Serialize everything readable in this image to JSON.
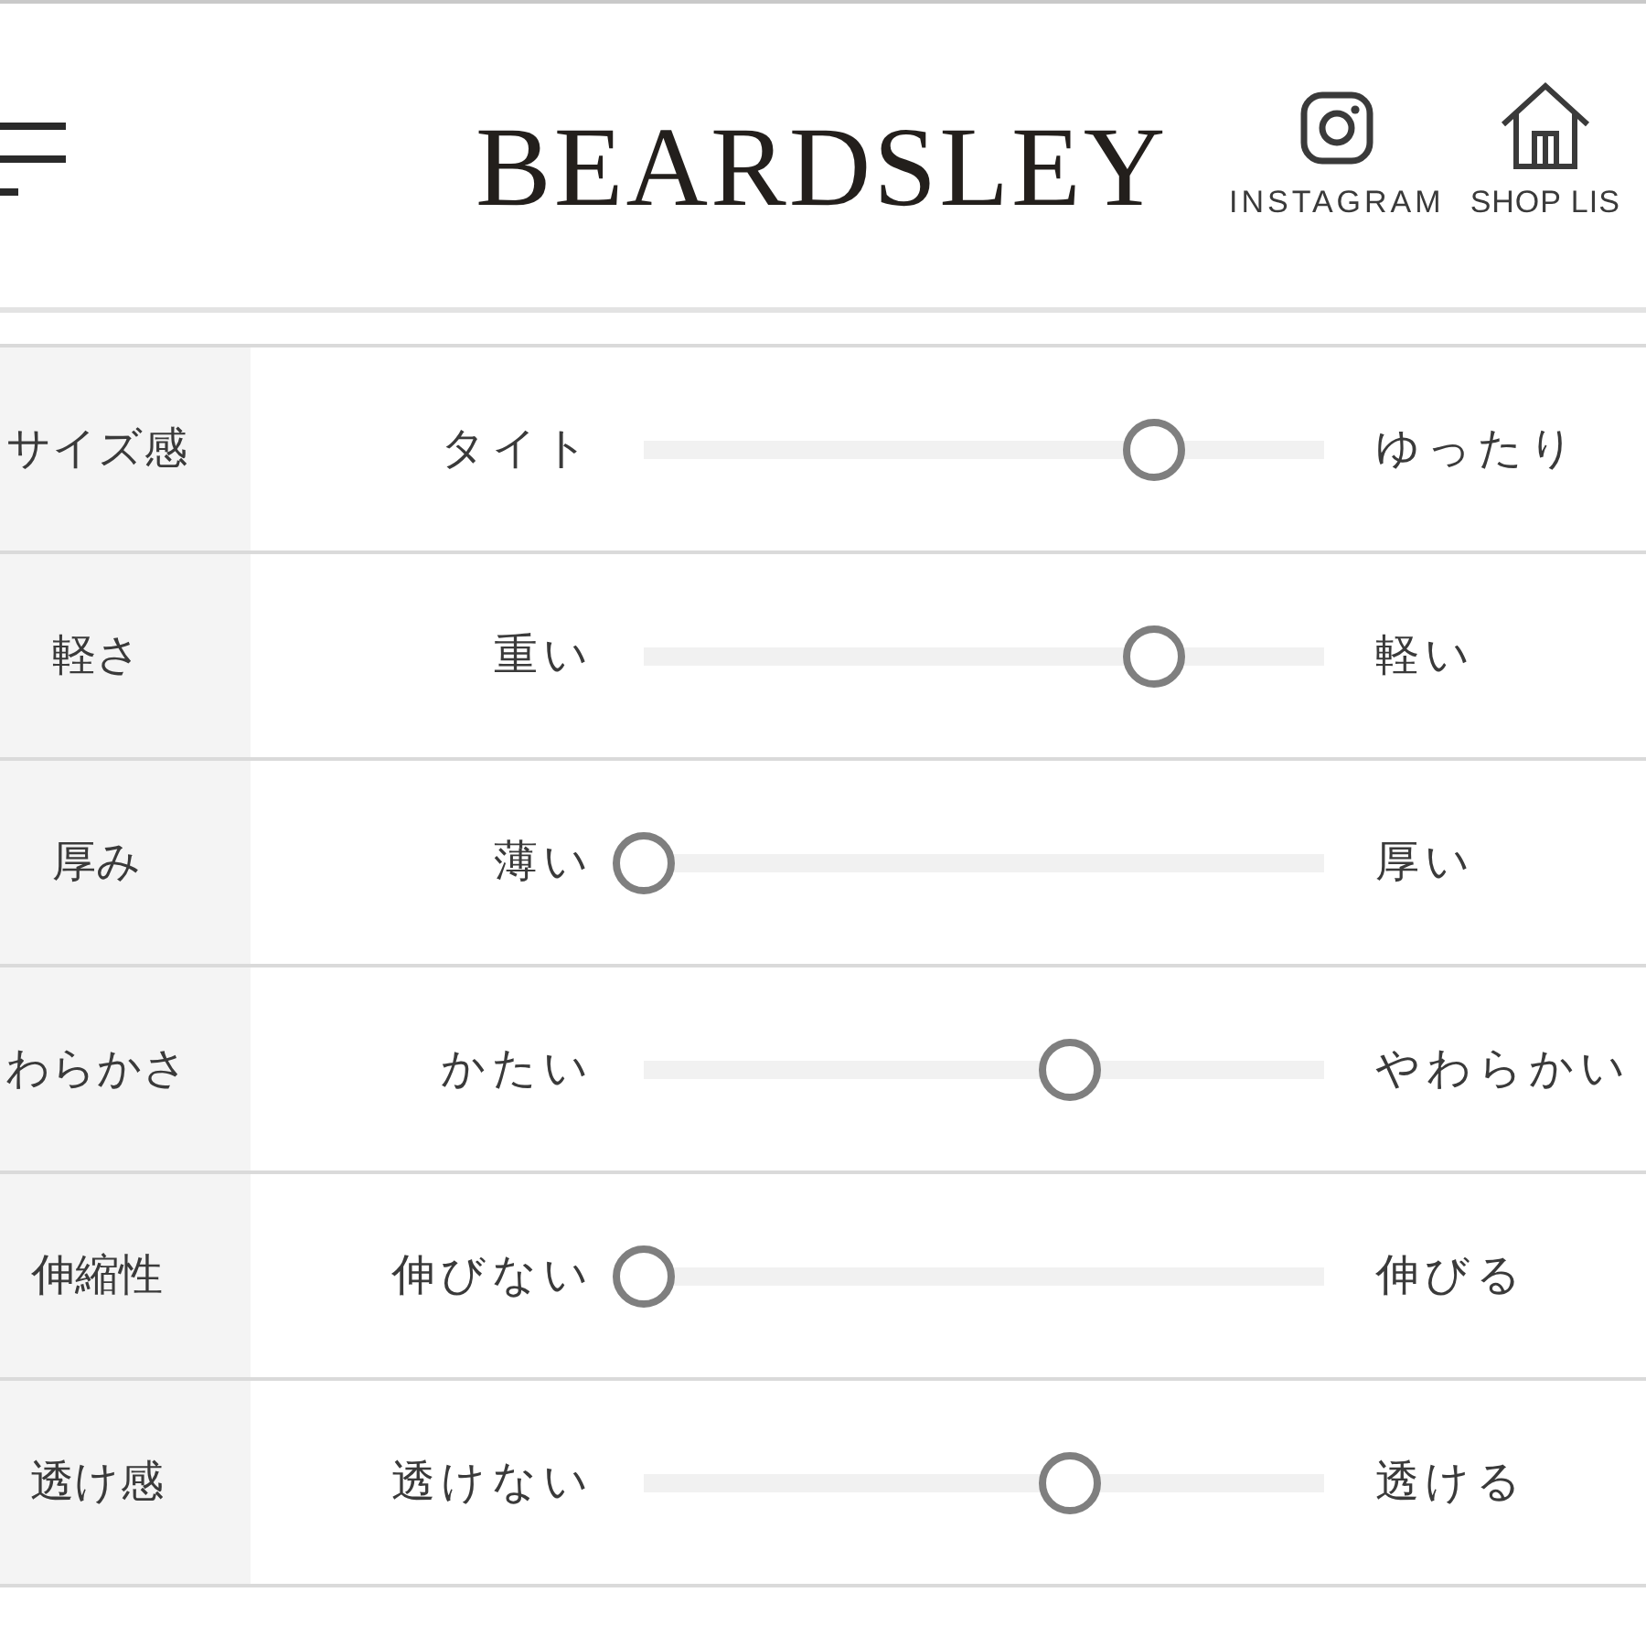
{
  "header": {
    "logo": "BEARDSLEY",
    "links": [
      {
        "kind": "instagram",
        "label": "INSTAGRAM"
      },
      {
        "kind": "shop",
        "label": "SHOP LIS"
      }
    ]
  },
  "attributes": [
    {
      "name": "サイズ感",
      "low": "タイト",
      "high": "ゆったり",
      "level": 0.75
    },
    {
      "name": "軽さ",
      "low": "重い",
      "high": "軽い",
      "level": 0.75
    },
    {
      "name": "厚み",
      "low": "薄い",
      "high": "厚い",
      "level": 0
    },
    {
      "name": "わらかさ",
      "low": "かたい",
      "high": "やわらかい",
      "level": 0.625
    },
    {
      "name": "伸縮性",
      "low": "伸びない",
      "high": "伸びる",
      "level": 0
    },
    {
      "name": "透け感",
      "low": "透けない",
      "high": "透ける",
      "level": 0.625
    }
  ]
}
